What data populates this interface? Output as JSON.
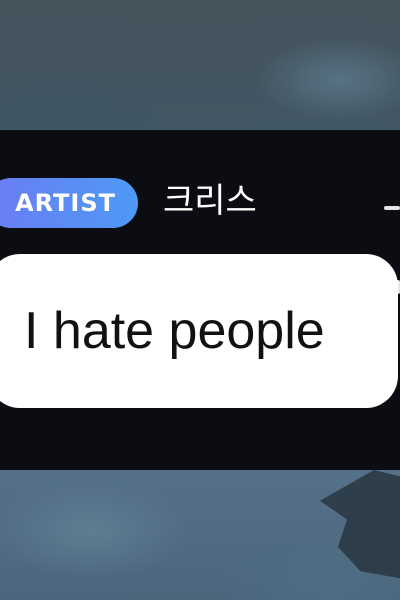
{
  "message": {
    "badge_label": "ARTIST",
    "username": "크리스",
    "text": "I hate people"
  },
  "colors": {
    "badge_gradient_start": "#6c7cf2",
    "badge_gradient_end": "#4d9af5",
    "band_background": "#0c0d12",
    "bubble_background": "#ffffff",
    "bubble_text": "#111111"
  }
}
